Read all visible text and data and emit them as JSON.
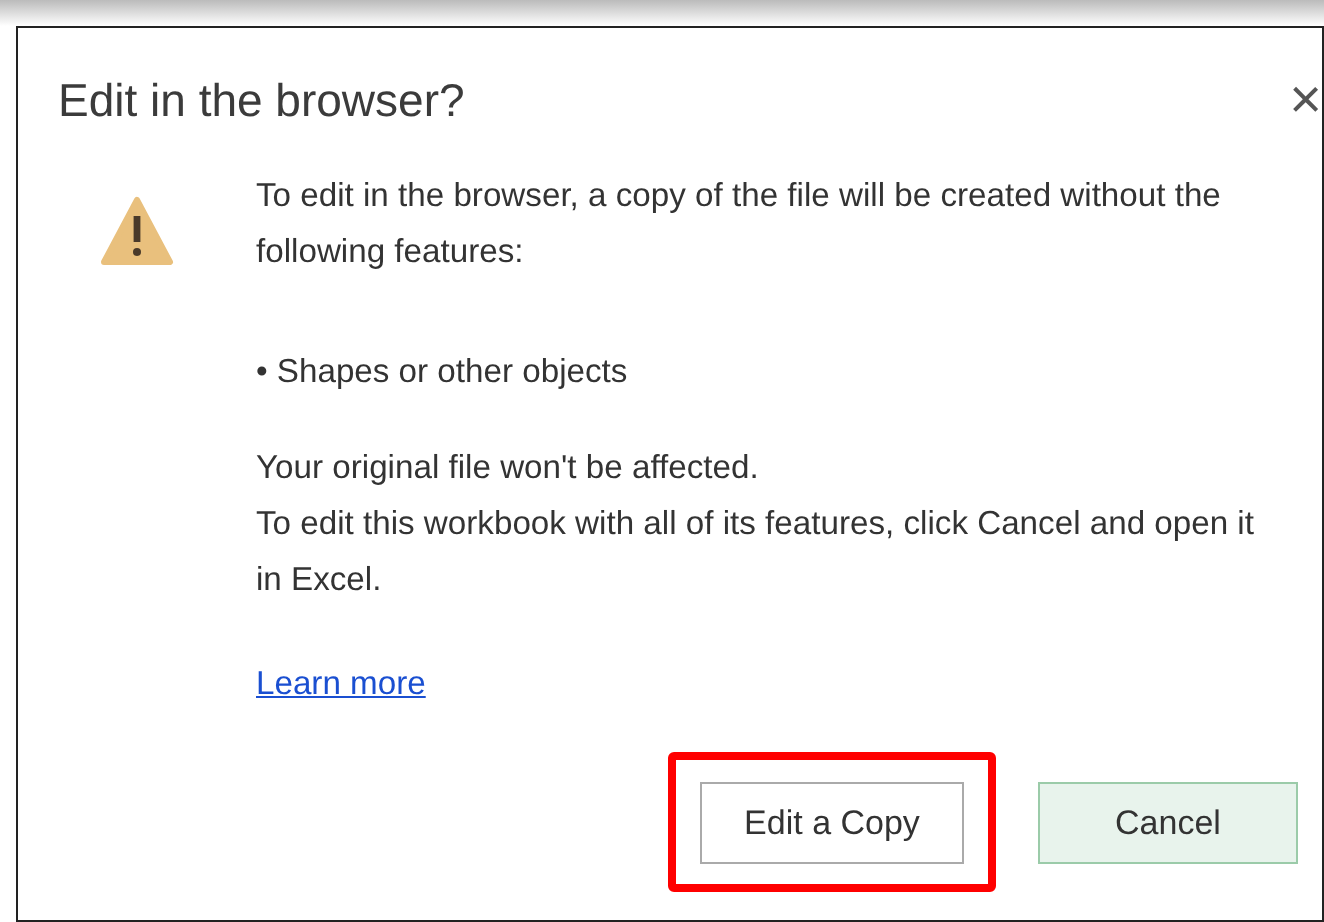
{
  "dialog": {
    "title": "Edit in the browser?",
    "close": "×",
    "message": "To edit in the browser, a copy of the file will be created without the following features:",
    "features": [
      "• Shapes or other objects"
    ],
    "notes": [
      "Your original file won't be affected.",
      "To edit this workbook with all of its features, click Cancel and open it in Excel."
    ],
    "link": "Learn more",
    "buttons": [
      {
        "label": "Edit a Copy",
        "kind": "secondary",
        "highlighted": true
      },
      {
        "label": "Cancel",
        "kind": "primary",
        "highlighted": false
      }
    ]
  }
}
